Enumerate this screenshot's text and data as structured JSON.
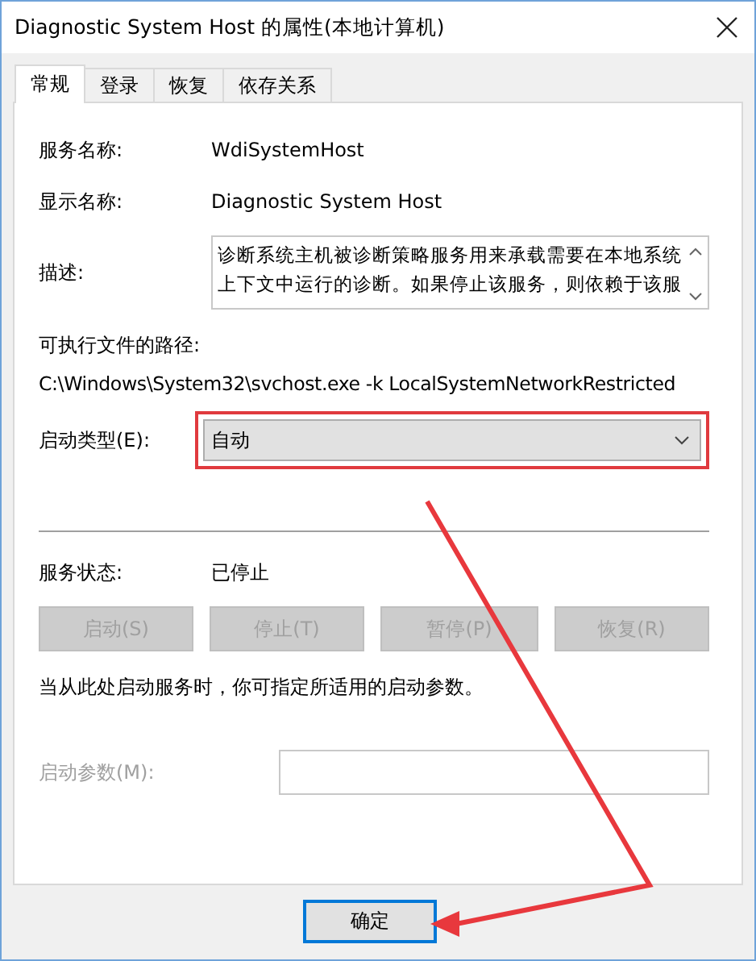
{
  "window": {
    "title": "Diagnostic System Host 的属性(本地计算机)"
  },
  "tabs": [
    {
      "label": "常规",
      "selected": true
    },
    {
      "label": "登录",
      "selected": false
    },
    {
      "label": "恢复",
      "selected": false
    },
    {
      "label": "依存关系",
      "selected": false
    }
  ],
  "info": [
    {
      "label": "服务名称:",
      "value": "WdiSystemHost"
    },
    {
      "label": "显示名称:",
      "value": "Diagnostic System Host"
    }
  ],
  "description": {
    "label": "描述:",
    "value": "诊断系统主机被诊断策略服务用来承载需要在本地系统上下文中运行的诊断。如果停止该服务，则依赖于该服"
  },
  "executable": {
    "label": "可执行文件的路径:",
    "value": "C:\\Windows\\System32\\svchost.exe -k LocalSystemNetworkRestricted"
  },
  "startup_type": {
    "label": "启动类型(E):",
    "value": "自动",
    "highlighted": true
  },
  "status": {
    "label": "服务状态:",
    "value": "已停止"
  },
  "service_buttons": [
    {
      "label": "启动(S)",
      "disabled": true
    },
    {
      "label": "停止(T)",
      "disabled": true
    },
    {
      "label": "暂停(P)",
      "disabled": true
    },
    {
      "label": "恢复(R)",
      "disabled": true
    }
  ],
  "hint": "当从此处启动服务时，你可指定所适用的启动参数。",
  "start_params": {
    "label": "启动参数(M):",
    "disabled": true
  },
  "buttons": [
    {
      "label": "确定",
      "default": true
    }
  ],
  "annotation_arrow": true
}
